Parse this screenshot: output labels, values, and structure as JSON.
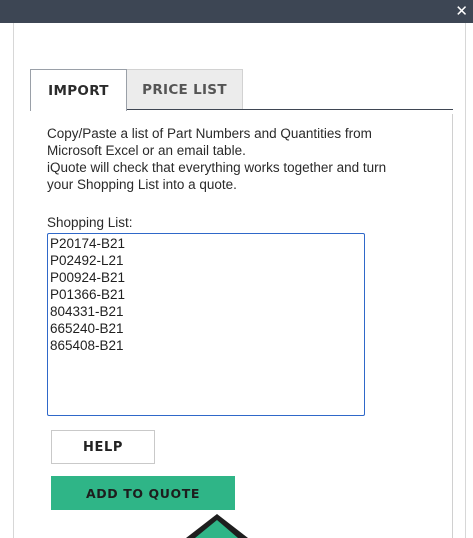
{
  "window": {
    "close_glyph": "✕"
  },
  "tabs": [
    {
      "label": "IMPORT",
      "active": true
    },
    {
      "label": "PRICE LIST",
      "active": false
    }
  ],
  "import_panel": {
    "description_lines": [
      "Copy/Paste a list of Part Numbers and Quantities from",
      "Microsoft Excel or an email table.",
      "iQuote will check that everything works together and turn",
      "your Shopping List into a quote."
    ],
    "shopping_list_label": "Shopping List:",
    "shopping_list_lines": [
      "P20174-B21",
      "P02492-L21",
      "P00924-B21",
      "P01366-B21",
      "804331-B21",
      "665240-B21",
      "865408-B21"
    ],
    "help_button_label": "HELP",
    "add_button_label": "ADD TO QUOTE"
  },
  "colors": {
    "titlebar": "#3d4654",
    "accent_green": "#2fb587",
    "input_border": "#2f68c9",
    "inactive_tab": "#ececec"
  },
  "icons": {
    "close": "close-icon",
    "pointer": "mouse-pointer-icon"
  }
}
